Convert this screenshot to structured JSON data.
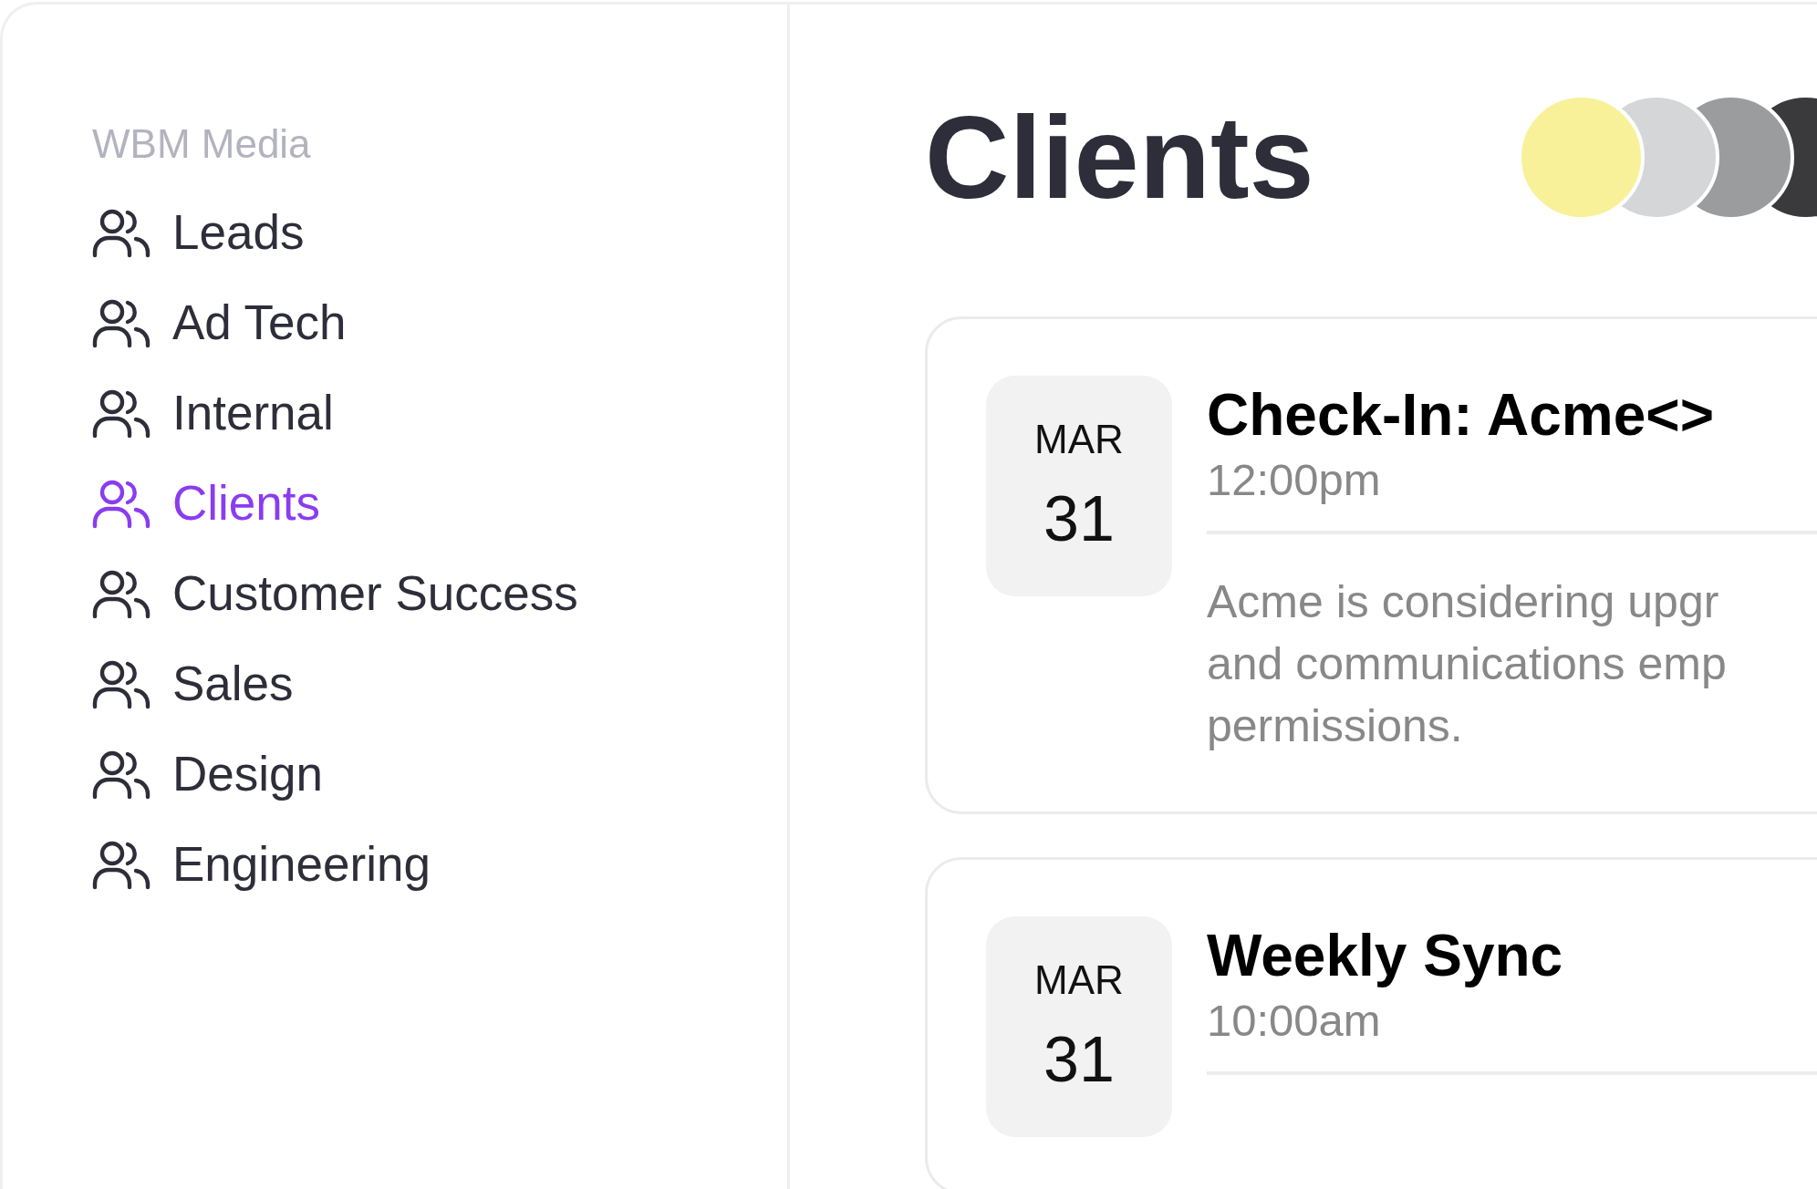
{
  "sidebar": {
    "workspace": "WBM Media",
    "items": [
      {
        "label": "Leads",
        "selected": false
      },
      {
        "label": "Ad Tech",
        "selected": false
      },
      {
        "label": "Internal",
        "selected": false
      },
      {
        "label": "Clients",
        "selected": true
      },
      {
        "label": "Customer Success",
        "selected": false
      },
      {
        "label": "Sales",
        "selected": false
      },
      {
        "label": "Design",
        "selected": false
      },
      {
        "label": "Engineering",
        "selected": false
      }
    ]
  },
  "main": {
    "title": "Clients",
    "avatars": [
      {
        "color": "#f8f19a"
      },
      {
        "color": "#d4d6d8"
      },
      {
        "color": "#9a9c9e"
      },
      {
        "color": "#3a3a3c"
      }
    ],
    "events": [
      {
        "month": "MAR",
        "day": "31",
        "title": "Check-In: Acme<>",
        "time": "12:00pm",
        "description_lines": [
          "Acme is considering upgr",
          "and communications emp",
          "permissions."
        ]
      },
      {
        "month": "MAR",
        "day": "31",
        "title": "Weekly Sync",
        "time": "10:00am"
      }
    ]
  }
}
